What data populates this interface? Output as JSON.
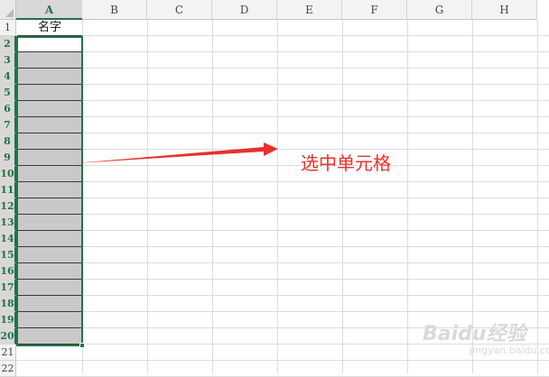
{
  "columns": [
    "A",
    "B",
    "C",
    "D",
    "E",
    "F",
    "G",
    "H"
  ],
  "rows": [
    "1",
    "2",
    "3",
    "4",
    "5",
    "6",
    "7",
    "8",
    "9",
    "10",
    "11",
    "12",
    "13",
    "14",
    "15",
    "16",
    "17",
    "18",
    "19",
    "20",
    "21",
    "22"
  ],
  "cells": {
    "A1": "名字"
  },
  "selected_column": "A",
  "annotation": "选中单元格",
  "watermark": {
    "brand": "Baidu经验",
    "url": "jingyan.baidu.com"
  },
  "colors": {
    "selection": "#217346",
    "annotation": "#e8312b",
    "filled_cell": "#c9c9c9"
  }
}
